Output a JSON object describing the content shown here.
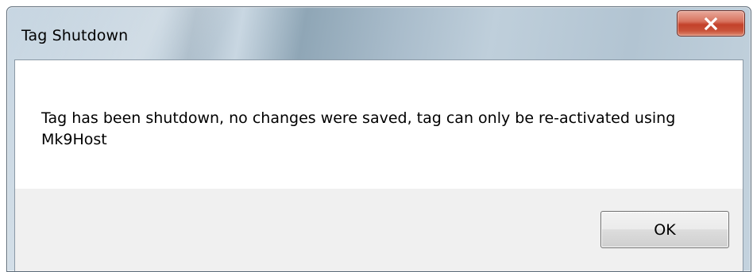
{
  "window": {
    "title": "Tag Shutdown"
  },
  "titlebar": {
    "close_icon": "close-x-icon"
  },
  "message": {
    "text": "Tag has been shutdown, no changes were saved, tag can only be re-activated using Mk9Host"
  },
  "buttons": {
    "ok_label": "OK"
  },
  "colors": {
    "close_button": "#c3412a",
    "client_background": "#f0f0f0",
    "message_background": "#ffffff"
  }
}
